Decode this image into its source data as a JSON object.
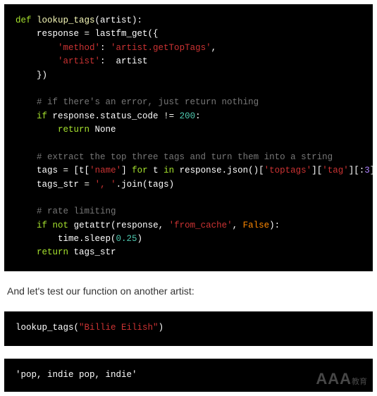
{
  "block1": {
    "l1": {
      "def": "def",
      "fn": "lookup_tags",
      "params": "(artist):"
    },
    "l2": {
      "a": "response ",
      "b": "=",
      "c": " lastfm_get({"
    },
    "l3": {
      "k": "'method'",
      "sep": ": ",
      "v": "'artist.getTopTags'",
      "end": ","
    },
    "l4": {
      "k": "'artist'",
      "sep": ":  ",
      "v": "artist"
    },
    "l5": "})",
    "l6": "",
    "l7": "# if there's an error, just return nothing",
    "l8": {
      "if": "if",
      "mid": " response.status_code ",
      "op": "!=",
      "sp": " ",
      "num": "200",
      "end": ":"
    },
    "l9": {
      "ret": "return",
      "val": " None"
    },
    "l10": "",
    "l11": "# extract the top three tags and turn them into a string",
    "l12": {
      "a": "tags ",
      "eq": "=",
      "b": " [t[",
      "k1": "'name'",
      "c": "] ",
      "for": "for",
      "d": " t ",
      "in": "in",
      "e": " response.json()[",
      "k2": "'toptags'",
      "f": "][",
      "k3": "'tag'",
      "g": "][:",
      "n": "3",
      "h": "]]"
    },
    "l13": {
      "a": "tags_str ",
      "eq": "=",
      "b": " ",
      "s": "', '",
      "c": ".join(tags)"
    },
    "l14": "",
    "l15": "# rate limiting",
    "l16": {
      "if": "if",
      "sp": " ",
      "not": "not",
      "a": " getattr(response, ",
      "s": "'from_cache'",
      "b": ", ",
      "false": "False",
      "c": "):"
    },
    "l17": {
      "a": "time.sleep(",
      "n": "0.25",
      "b": ")"
    },
    "l18": {
      "ret": "return",
      "a": " tags_str"
    }
  },
  "prose1": "And let's test our function on another artist:",
  "block2": {
    "fn": "lookup_tags",
    "open": "(",
    "arg": "\"Billie Eilish\"",
    "close": ")"
  },
  "output1": "'pop, indie pop, indie'",
  "watermark": {
    "main": "AAA",
    "sub": "教育"
  }
}
